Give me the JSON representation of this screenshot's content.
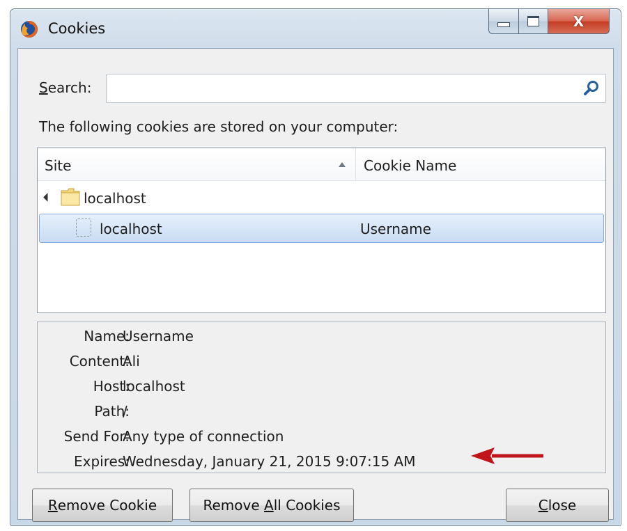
{
  "window": {
    "title": "Cookies",
    "caption_buttons": {
      "close_glyph": "X"
    }
  },
  "search": {
    "label_first": "S",
    "label_rest": "earch:",
    "value": "",
    "placeholder": ""
  },
  "intro": "The following cookies are stored on your computer:",
  "tree": {
    "columns": {
      "site": "Site",
      "cookie_name": "Cookie Name",
      "sort": "ascending"
    },
    "rows": [
      {
        "type": "folder",
        "expanded": true,
        "site": "localhost",
        "cookie_name": ""
      },
      {
        "type": "cookie",
        "selected": true,
        "site": "localhost",
        "cookie_name": "Username"
      }
    ]
  },
  "details": [
    {
      "label": "Name:",
      "value": "Username"
    },
    {
      "label": "Content:",
      "value": "Ali"
    },
    {
      "label": "Host:",
      "value": "localhost"
    },
    {
      "label": "Path:",
      "value": "/"
    },
    {
      "label": "Send For:",
      "value": "Any type of connection"
    },
    {
      "label": "Expires:",
      "value": "Wednesday, January 21, 2015 9:07:15 AM"
    }
  ],
  "buttons": {
    "remove": {
      "mnemonic": "R",
      "rest": "emove Cookie"
    },
    "remove_all": {
      "pre": "Remove ",
      "mnemonic": "A",
      "rest": "ll Cookies"
    },
    "close": {
      "mnemonic": "C",
      "rest": "lose"
    }
  },
  "colors": {
    "annotation_arrow": "#c0151b",
    "selection": "#cde0f5"
  }
}
